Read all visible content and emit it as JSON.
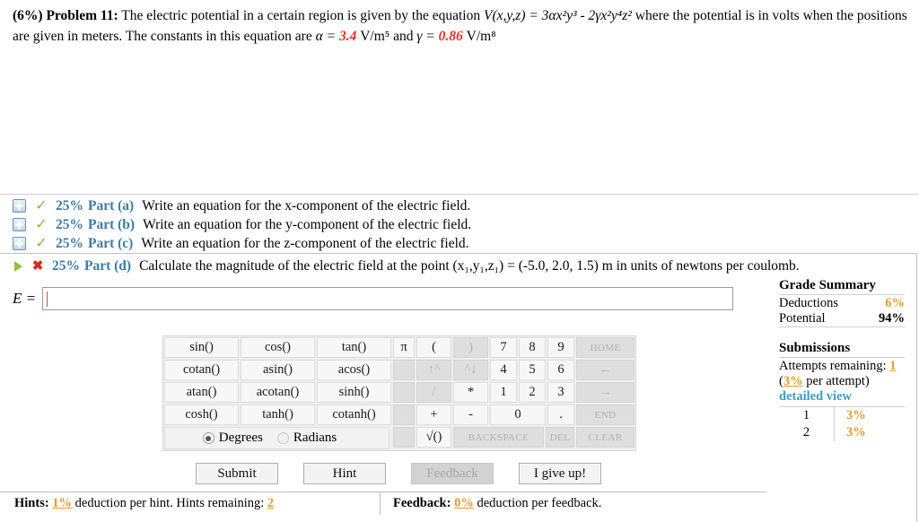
{
  "problem": {
    "weight": "(6%)",
    "label": "Problem 11:",
    "text_1": "The electric potential in a certain region is given by the equation ",
    "equation": "V(x,y,z) = 3αx²y³ - 2γx²y⁴z²",
    "text_2": " where the potential is in volts when the positions are given in meters. The constants in this equation are ",
    "alpha_symbol": "α = ",
    "alpha_value": "3.4",
    "alpha_unit": "V/m⁵",
    "and_word": " and ",
    "gamma_symbol": "γ = ",
    "gamma_value": "0.86",
    "gamma_unit": "V/m⁸"
  },
  "parts": [
    {
      "weight": "25%",
      "label": "Part (a)",
      "text": "Write an equation for the x-component of the electric field.",
      "status": "correct",
      "icon": "expand-plus-icon",
      "status_icon": "green-check-icon"
    },
    {
      "weight": "25%",
      "label": "Part (b)",
      "text": "Write an equation for the y-component of the electric field.",
      "status": "correct",
      "icon": "expand-plus-icon",
      "status_icon": "green-check-icon"
    },
    {
      "weight": "25%",
      "label": "Part (c)",
      "text": "Write an equation for the z-component of the electric field.",
      "status": "correct",
      "icon": "expand-plus-icon",
      "status_icon": "green-check-icon"
    }
  ],
  "active_part": {
    "weight": "25%",
    "label": "Part (d)",
    "text": "Calculate the magnitude of the electric field at the point (x₁,y₁,z₁) = (-5.0, 2.0, 1.5) m in units of newtons per coulomb.",
    "icon": "green-play-triangle-icon",
    "status_icon": "red-x-icon"
  },
  "answer": {
    "label": "E =",
    "value": "",
    "placeholder": ""
  },
  "calculator": {
    "functions": [
      [
        "sin()",
        "cos()",
        "tan()"
      ],
      [
        "cotan()",
        "asin()",
        "acos()"
      ],
      [
        "atan()",
        "acotan()",
        "sinh()"
      ],
      [
        "cosh()",
        "tanh()",
        "cotanh()"
      ]
    ],
    "mode": {
      "degrees_label": "Degrees",
      "radians_label": "Radians",
      "selected": "Degrees"
    },
    "keypad": [
      [
        {
          "label": "π",
          "disabled": false
        },
        {
          "label": "(",
          "disabled": false
        },
        {
          "label": ")",
          "disabled": true
        },
        {
          "label": "7",
          "disabled": false
        },
        {
          "label": "8",
          "disabled": false
        },
        {
          "label": "9",
          "disabled": false
        },
        {
          "label": "HOME",
          "disabled": true
        }
      ],
      [
        {
          "label": "",
          "disabled": true
        },
        {
          "label": "↑^",
          "disabled": true
        },
        {
          "label": "^↓",
          "disabled": true
        },
        {
          "label": "4",
          "disabled": false
        },
        {
          "label": "5",
          "disabled": false
        },
        {
          "label": "6",
          "disabled": false
        },
        {
          "label": "←",
          "disabled": true
        }
      ],
      [
        {
          "label": "",
          "disabled": true
        },
        {
          "label": "/",
          "disabled": true
        },
        {
          "label": "*",
          "disabled": false
        },
        {
          "label": "1",
          "disabled": false
        },
        {
          "label": "2",
          "disabled": false
        },
        {
          "label": "3",
          "disabled": false
        },
        {
          "label": "→",
          "disabled": true
        }
      ],
      [
        {
          "label": "",
          "disabled": true
        },
        {
          "label": "+",
          "disabled": false
        },
        {
          "label": "-",
          "disabled": false
        },
        {
          "label": "0",
          "disabled": false
        },
        {
          "label": ".",
          "disabled": false
        },
        {
          "label": "END",
          "disabled": true
        }
      ],
      [
        {
          "label": "",
          "disabled": true
        },
        {
          "label": "√()",
          "disabled": false
        },
        {
          "label": "BACKSPACE",
          "disabled": true
        },
        {
          "label": "DEL",
          "disabled": true
        },
        {
          "label": "CLEAR",
          "disabled": true
        }
      ]
    ]
  },
  "actions": [
    {
      "label": "Submit",
      "disabled": false
    },
    {
      "label": "Hint",
      "disabled": false
    },
    {
      "label": "Feedback",
      "disabled": true
    },
    {
      "label": "I give up!",
      "disabled": false
    }
  ],
  "bottom_bar": {
    "hints_label": "Hints:",
    "hints_pct": "1%",
    "hints_text_1": "deduction per hint. Hints remaining:",
    "hints_remaining": "2",
    "feedback_label": "Feedback:",
    "feedback_pct": "0%",
    "feedback_text": "deduction per feedback."
  },
  "grade_summary": {
    "title": "Grade Summary",
    "deductions_label": "Deductions",
    "deductions_value": "6%",
    "potential_label": "Potential",
    "potential_value": "94%",
    "submissions_title": "Submissions",
    "attempts_label": "Attempts remaining:",
    "attempts_value": "1",
    "per_attempt_open": "(",
    "per_attempt_pct": "3%",
    "per_attempt_text": "per attempt)",
    "detailed_view": "detailed view",
    "rows": [
      {
        "index": "1",
        "pct": "3%"
      },
      {
        "index": "2",
        "pct": "3%"
      }
    ]
  },
  "colors": {
    "accent_blue": "#3a7ca8",
    "link_blue": "#3a9ec4",
    "orange": "#e8992a",
    "red": "#e8312a",
    "green": "#7cbf3f"
  }
}
